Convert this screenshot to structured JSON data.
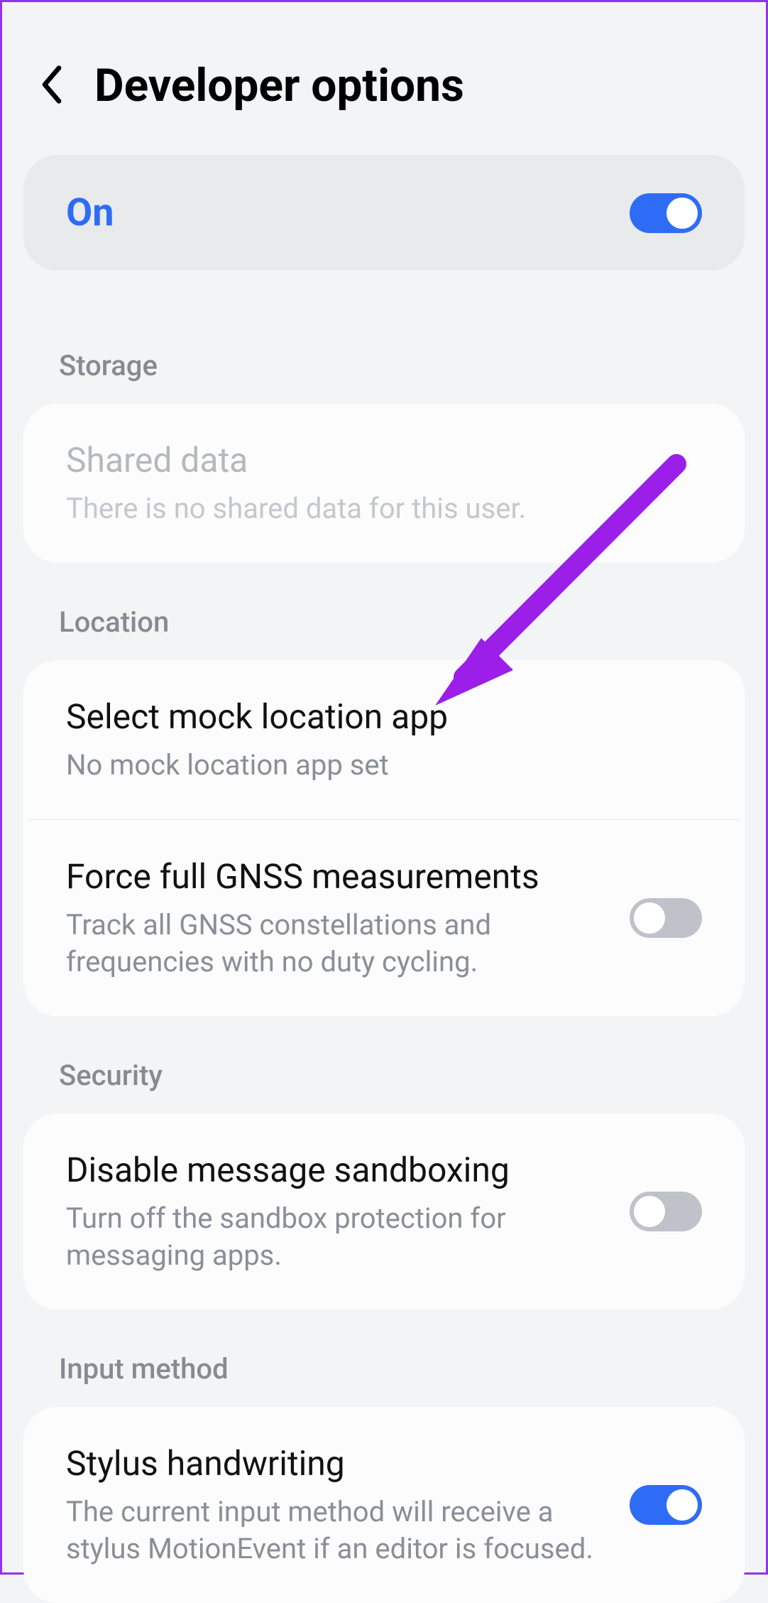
{
  "header": {
    "title": "Developer options"
  },
  "master": {
    "label": "On",
    "enabled": true
  },
  "sections": {
    "storage": {
      "label": "Storage",
      "items": {
        "shared_data": {
          "title": "Shared data",
          "sub": "There is no shared data for this user."
        }
      }
    },
    "location": {
      "label": "Location",
      "items": {
        "mock": {
          "title": "Select mock location app",
          "sub": "No mock location app set"
        },
        "gnss": {
          "title": "Force full GNSS measurements",
          "sub": "Track all GNSS constellations and frequencies with no duty cycling.",
          "toggle": false
        }
      }
    },
    "security": {
      "label": "Security",
      "items": {
        "sandbox": {
          "title": "Disable message sandboxing",
          "sub": "Turn off the sandbox protection for messaging apps.",
          "toggle": false
        }
      }
    },
    "input": {
      "label": "Input method",
      "items": {
        "stylus": {
          "title": "Stylus handwriting",
          "sub": "The current input method will receive a stylus MotionEvent if an editor is focused.",
          "toggle": true
        }
      }
    }
  },
  "annotation": {
    "arrow_color": "#9b1fe8"
  }
}
